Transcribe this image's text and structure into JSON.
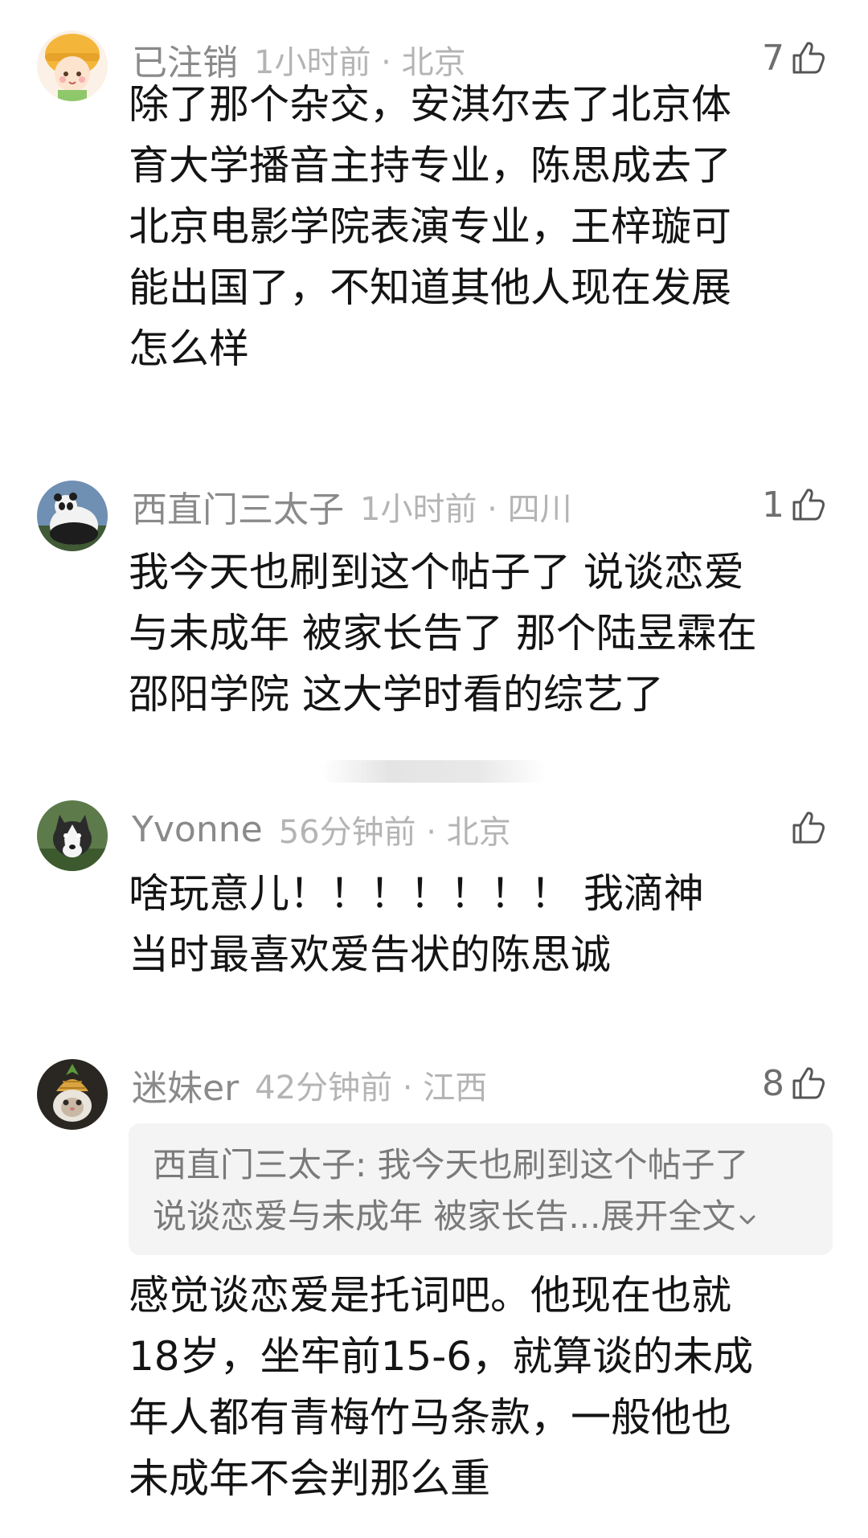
{
  "comments": [
    {
      "username": "已注销",
      "meta": "1小时前 · 北京",
      "likes": "7",
      "avatar": "cartoon-girl-avatar",
      "lines": [
        "除了那个杂交，安淇尔去了北京体",
        "育大学播音主持专业，陈思成去了",
        "北京电影学院表演专业，王梓璇可",
        "能出国了，不知道其他人现在发展",
        "怎么样"
      ]
    },
    {
      "username": "西直门三太子",
      "meta": "1小时前 · 四川",
      "likes": "1",
      "avatar": "panda-avatar",
      "lines": [
        "我今天也刷到这个帖子了 说谈恋爱",
        "与未成年 被家长告了 那个陆昱霖在",
        "邵阳学院 这大学时看的综艺了"
      ]
    },
    {
      "username": "Yvonne",
      "meta": "56分钟前 · 北京",
      "likes": "",
      "avatar": "husky-avatar",
      "lines": [
        "啥玩意儿！！！！！！！ 我滴神",
        "当时最喜欢爱告状的陈思诚"
      ]
    },
    {
      "username": "迷妹er",
      "meta": "42分钟前 · 江西",
      "likes": "8",
      "avatar": "pineapple-cat-avatar",
      "quote": {
        "line1": "西直门三太子: 我今天也刷到这个帖子了",
        "line2": "说谈恋爱与未成年 被家长告...",
        "expand": "展开全文"
      },
      "lines": [
        "感觉谈恋爱是托词吧。他现在也就",
        "18岁，坐牢前15-6，就算谈的未成",
        "年人都有青梅竹马条款，一般他也",
        "未成年不会判那么重"
      ]
    }
  ],
  "icons": {
    "like": "thumbs-up-icon",
    "expand": "chevron-down-icon"
  },
  "colors": {
    "username": "#8a8a8a",
    "meta": "#b4b4b4",
    "body": "#141414",
    "quote_bg": "#f4f4f4"
  }
}
